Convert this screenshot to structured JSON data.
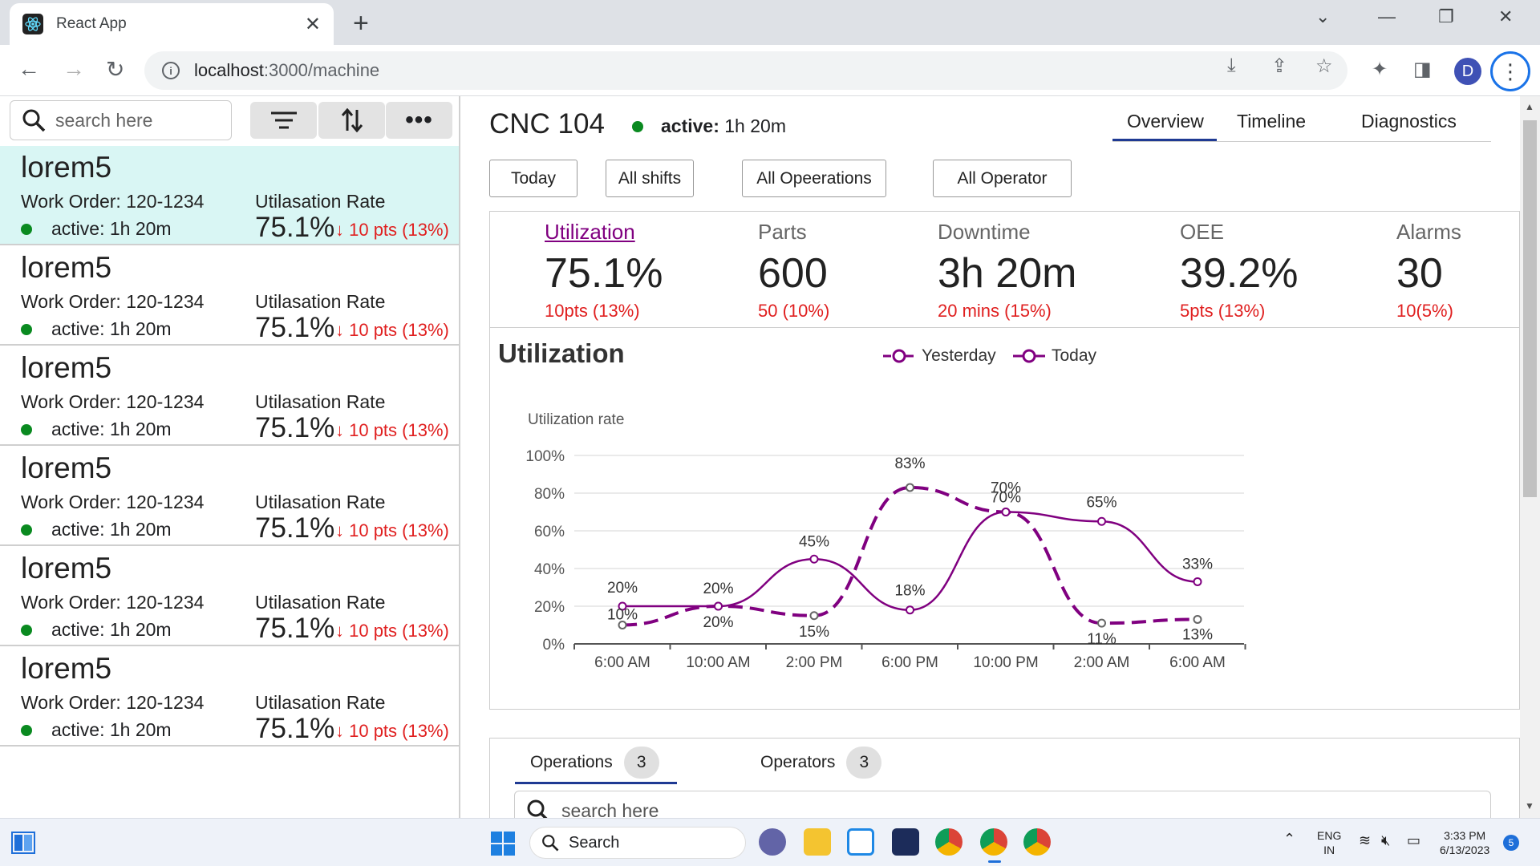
{
  "browser": {
    "tab_title": "React App",
    "url_host": "localhost",
    "url_rest": ":3000/machine",
    "profile_initial": "D"
  },
  "sidebar": {
    "search_placeholder": "search here",
    "items": [
      {
        "name": "lorem5",
        "wo_label": "Work Order:",
        "wo_value": "120-1234",
        "status_label": "active:",
        "status_value": "1h 20m",
        "rate_label": "Utilasation Rate",
        "rate_value": "75.1%",
        "delta": "↓ 10 pts (13%)"
      },
      {
        "name": "lorem5",
        "wo_label": "Work Order:",
        "wo_value": "120-1234",
        "status_label": "active:",
        "status_value": "1h 20m",
        "rate_label": "Utilasation Rate",
        "rate_value": "75.1%",
        "delta": "↓ 10 pts (13%)"
      },
      {
        "name": "lorem5",
        "wo_label": "Work Order:",
        "wo_value": "120-1234",
        "status_label": "active:",
        "status_value": "1h 20m",
        "rate_label": "Utilasation Rate",
        "rate_value": "75.1%",
        "delta": "↓ 10 pts (13%)"
      },
      {
        "name": "lorem5",
        "wo_label": "Work Order:",
        "wo_value": "120-1234",
        "status_label": "active:",
        "status_value": "1h 20m",
        "rate_label": "Utilasation Rate",
        "rate_value": "75.1%",
        "delta": "↓ 10 pts (13%)"
      },
      {
        "name": "lorem5",
        "wo_label": "Work Order:",
        "wo_value": "120-1234",
        "status_label": "active:",
        "status_value": "1h 20m",
        "rate_label": "Utilasation Rate",
        "rate_value": "75.1%",
        "delta": "↓ 10 pts (13%)"
      },
      {
        "name": "lorem5",
        "wo_label": "Work Order:",
        "wo_value": "120-1234",
        "status_label": "active:",
        "status_value": "1h 20m",
        "rate_label": "Utilasation Rate",
        "rate_value": "75.1%",
        "delta": "↓ 10 pts (13%)"
      }
    ]
  },
  "header": {
    "machine_name": "CNC 104",
    "status_label": "active:",
    "status_value": "1h 20m",
    "tabs": [
      "Overview",
      "Timeline",
      "Diagnostics"
    ]
  },
  "filters": [
    "Today",
    "All shifts",
    "All Opeerations",
    "All Operator"
  ],
  "kpis": [
    {
      "label": "Utilization",
      "value": "75.1%",
      "delta": "10pts (13%)"
    },
    {
      "label": "Parts",
      "value": "600",
      "delta": "50 (10%)"
    },
    {
      "label": "Downtime",
      "value": "3h 20m",
      "delta": "20 mins (15%)"
    },
    {
      "label": "OEE",
      "value": "39.2%",
      "delta": "5pts (13%)"
    },
    {
      "label": "Alarms",
      "value": "30",
      "delta": "10(5%)"
    }
  ],
  "chart_title": "Utilization",
  "chart_data": {
    "type": "line",
    "ylabel": "Utilization rate",
    "ylim": [
      0,
      100
    ],
    "yticks": [
      "0%",
      "20%",
      "40%",
      "60%",
      "80%",
      "100%"
    ],
    "categories": [
      "6:00 AM",
      "10:00 AM",
      "2:00 PM",
      "6:00 PM",
      "10:00 PM",
      "2:00 AM",
      "6:00 AM"
    ],
    "series": [
      {
        "name": "Yesterday",
        "style": "dashed",
        "values": [
          10,
          20,
          15,
          83,
          70,
          11,
          13
        ],
        "labels": [
          "10%",
          "20%",
          "15%",
          "83%",
          "70%",
          "11%",
          "13%"
        ]
      },
      {
        "name": "Today",
        "style": "solid",
        "values": [
          20,
          20,
          45,
          18,
          70,
          65,
          33
        ],
        "labels": [
          "20%",
          "20%",
          "45%",
          "18%",
          "70%",
          "65%",
          "33%"
        ]
      }
    ],
    "legend_position": "top",
    "color": "#800080"
  },
  "bottom": {
    "tabs": [
      {
        "label": "Operations",
        "count": "3"
      },
      {
        "label": "Operators",
        "count": "3"
      }
    ],
    "search_placeholder": "search here"
  },
  "taskbar": {
    "search_label": "Search",
    "lang": "ENG",
    "region": "IN",
    "time": "3:33 PM",
    "date": "6/13/2023",
    "notif_count": "5"
  }
}
